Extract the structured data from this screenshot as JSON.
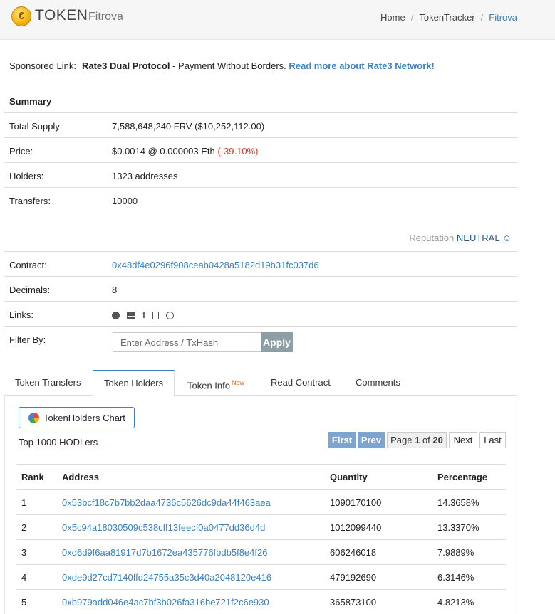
{
  "header": {
    "logo_glyph": "€",
    "logo_text": "TOKEN",
    "logo_sub": "Fitrova",
    "breadcrumb": [
      "Home",
      "TokenTracker",
      "Fitrova"
    ]
  },
  "sponsored": {
    "prefix": "Sponsored Link:",
    "title": "Rate3 Dual Protocol",
    "text": " - Payment Without Borders. ",
    "link": "Read more about Rate3 Network!"
  },
  "summary": {
    "heading": "Summary",
    "rows": [
      {
        "label": "Total Supply:",
        "value": "7,588,648,240 FRV ($10,252,112.00)"
      },
      {
        "label": "Price:",
        "value": "$0.0014 @ 0.000003 Eth ",
        "change": "(-39.10%)"
      },
      {
        "label": "Holders:",
        "value": "1323 addresses"
      },
      {
        "label": "Transfers:",
        "value": "10000"
      }
    ]
  },
  "reputation": {
    "label": "Reputation ",
    "level": "NEUTRAL",
    "icon": "smiley-icon"
  },
  "details": {
    "contract_label": "Contract:",
    "contract": "0x48df4e0296f908ceab0428a5182d19b31fc037d6",
    "decimals_label": "Decimals:",
    "decimals": "8",
    "links_label": "Links:",
    "link_icons": [
      "globe-icon",
      "mail-icon",
      "facebook-icon",
      "document-icon",
      "coinmarketcap-icon"
    ],
    "filter_label": "Filter By:",
    "filter_placeholder": "Enter Address / TxHash",
    "apply": "Apply"
  },
  "tabs": [
    {
      "label": "Token Transfers",
      "active": false
    },
    {
      "label": "Token Holders",
      "active": true
    },
    {
      "label": "Token Info",
      "badge": "New",
      "active": false
    },
    {
      "label": "Read Contract",
      "active": false
    },
    {
      "label": "Comments",
      "active": false
    }
  ],
  "holders": {
    "chart_button": "TokenHolders Chart",
    "top_label": "Top 1000 HODLers",
    "pager": {
      "first": "First",
      "prev": "Prev",
      "page_prefix": "Page ",
      "page": "1",
      "of": " of ",
      "total": "20",
      "next": "Next",
      "last": "Last"
    },
    "columns": [
      "Rank",
      "Address",
      "Quantity",
      "Percentage"
    ],
    "rows": [
      {
        "rank": "1",
        "address": "0x53bcf18c7b7bb2daa4736c5626dc9da44f463aea",
        "quantity": "1090170100",
        "percentage": "14.3658%"
      },
      {
        "rank": "2",
        "address": "0x5c94a18030509c538cff13feecf0a0477dd36d4d",
        "quantity": "1012099440",
        "percentage": "13.3370%"
      },
      {
        "rank": "3",
        "address": "0xd6d9f6aa81917d7b1672ea435776fbdb5f8e4f26",
        "quantity": "606246018",
        "percentage": "7.9889%"
      },
      {
        "rank": "4",
        "address": "0xde9d27cd7140ffd24755a35c3d40a2048120e416",
        "quantity": "479192690",
        "percentage": "6.3146%"
      },
      {
        "rank": "5",
        "address": "0xb979add046e4ac7bf3b026fa316be721f2c6e930",
        "quantity": "365873100",
        "percentage": "4.8213%"
      }
    ]
  }
}
